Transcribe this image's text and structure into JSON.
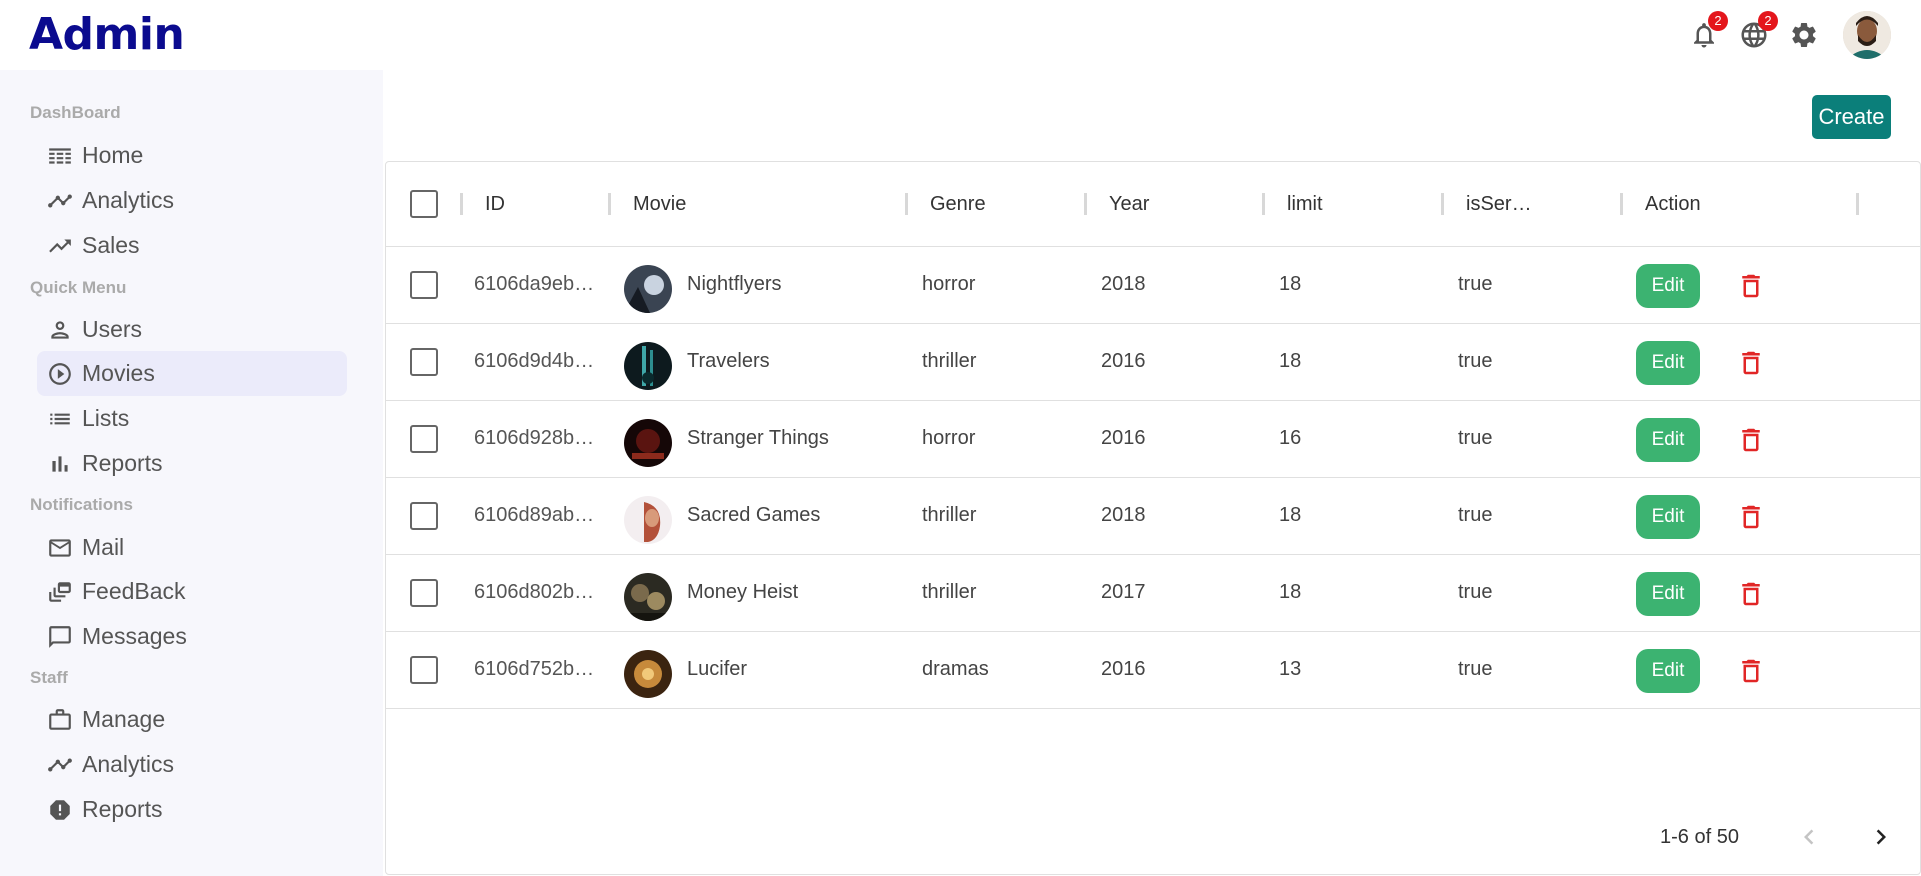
{
  "header": {
    "title": "Admin",
    "notifications_count": "2",
    "language_count": "2"
  },
  "sidebar": {
    "sections": [
      {
        "title": "DashBoard",
        "items": [
          {
            "label": "Home",
            "icon": "home-icon"
          },
          {
            "label": "Analytics",
            "icon": "timeline-icon"
          },
          {
            "label": "Sales",
            "icon": "trending-up-icon"
          }
        ]
      },
      {
        "title": "Quick Menu",
        "items": [
          {
            "label": "Users",
            "icon": "person-icon"
          },
          {
            "label": "Movies",
            "icon": "play-circle-icon",
            "active": true
          },
          {
            "label": "Lists",
            "icon": "list-icon"
          },
          {
            "label": "Reports",
            "icon": "bar-chart-icon"
          }
        ]
      },
      {
        "title": "Notifications",
        "items": [
          {
            "label": "Mail",
            "icon": "mail-icon"
          },
          {
            "label": "FeedBack",
            "icon": "dynamic-feed-icon"
          },
          {
            "label": "Messages",
            "icon": "chat-icon"
          }
        ]
      },
      {
        "title": "Staff",
        "items": [
          {
            "label": "Manage",
            "icon": "work-icon"
          },
          {
            "label": "Analytics",
            "icon": "timeline-icon"
          },
          {
            "label": "Reports",
            "icon": "report-icon"
          }
        ]
      }
    ]
  },
  "toolbar": {
    "create_label": "Create"
  },
  "table": {
    "columns": [
      "ID",
      "Movie",
      "Genre",
      "Year",
      "limit",
      "isSer…",
      "Action"
    ],
    "edit_label": "Edit",
    "rows": [
      {
        "id": "6106da9eb…",
        "movie": "Nightflyers",
        "genre": "horror",
        "year": "2018",
        "limit": "18",
        "is_series": "true"
      },
      {
        "id": "6106d9d4b…",
        "movie": "Travelers",
        "genre": "thriller",
        "year": "2016",
        "limit": "18",
        "is_series": "true"
      },
      {
        "id": "6106d928b…",
        "movie": "Stranger Things",
        "genre": "horror",
        "year": "2016",
        "limit": "16",
        "is_series": "true"
      },
      {
        "id": "6106d89ab…",
        "movie": "Sacred Games",
        "genre": "thriller",
        "year": "2018",
        "limit": "18",
        "is_series": "true"
      },
      {
        "id": "6106d802b…",
        "movie": "Money Heist",
        "genre": "thriller",
        "year": "2017",
        "limit": "18",
        "is_series": "true"
      },
      {
        "id": "6106d752b…",
        "movie": "Lucifer",
        "genre": "dramas",
        "year": "2016",
        "limit": "13",
        "is_series": "true"
      }
    ]
  },
  "pagination": {
    "label": "1-6 of 50"
  },
  "colors": {
    "brand": "#0b0b8f",
    "create": "#0b7f7a",
    "edit": "#3cb371",
    "delete": "#e12626",
    "badge": "#e4161c"
  }
}
